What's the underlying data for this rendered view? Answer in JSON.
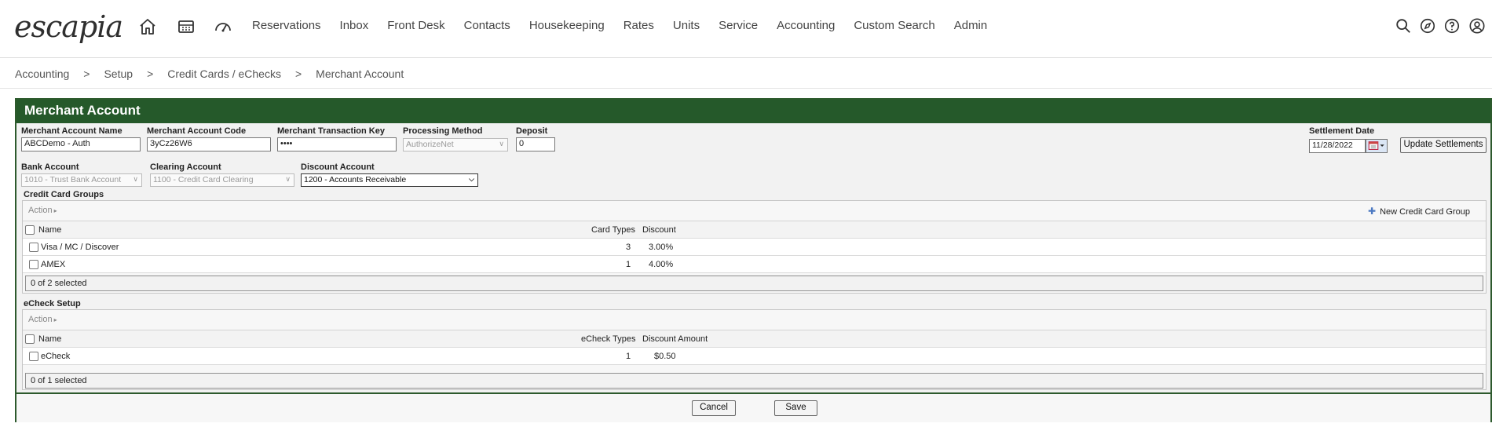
{
  "app": {
    "logo_text": "escapia",
    "nav": [
      "Reservations",
      "Inbox",
      "Front Desk",
      "Contacts",
      "Housekeeping",
      "Rates",
      "Units",
      "Service",
      "Accounting",
      "Custom Search",
      "Admin"
    ]
  },
  "breadcrumb": [
    "Accounting",
    "Setup",
    "Credit Cards / eChecks",
    "Merchant Account"
  ],
  "panel": {
    "title": "Merchant Account",
    "fields": {
      "merchant_account_name": {
        "label": "Merchant Account Name",
        "value": "ABCDemo - Auth"
      },
      "merchant_account_code": {
        "label": "Merchant Account Code",
        "value": "3yCz26W6"
      },
      "merchant_transaction_key": {
        "label": "Merchant Transaction Key",
        "value": "••••"
      },
      "processing_method": {
        "label": "Processing Method",
        "value": "AuthorizeNet"
      },
      "deposit": {
        "label": "Deposit",
        "value": "0"
      },
      "settlement_date": {
        "label": "Settlement Date",
        "value": "11/28/2022"
      },
      "bank_account": {
        "label": "Bank Account",
        "value": "1010 - Trust Bank Account"
      },
      "clearing_account": {
        "label": "Clearing Account",
        "value": "1100 - Credit Card Clearing"
      },
      "discount_account": {
        "label": "Discount Account",
        "value": "1200 - Accounts Receivable"
      }
    },
    "update_settlements_label": "Update Settlements",
    "credit_card_groups": {
      "title": "Credit Card Groups",
      "action_label": "Action",
      "new_label": "New Credit Card Group",
      "columns": [
        "Name",
        "Card Types",
        "Discount"
      ],
      "rows": [
        {
          "name": "Visa / MC / Discover",
          "types": "3",
          "discount": "3.00%"
        },
        {
          "name": "AMEX",
          "types": "1",
          "discount": "4.00%"
        }
      ],
      "footer": "0 of 2 selected"
    },
    "echeck_setup": {
      "title": "eCheck Setup",
      "action_label": "Action",
      "columns": [
        "Name",
        "eCheck Types",
        "Discount Amount"
      ],
      "rows": [
        {
          "name": "eCheck",
          "types": "1",
          "discount": "$0.50"
        }
      ],
      "footer": "0 of 1 selected"
    },
    "cancel_label": "Cancel",
    "save_label": "Save"
  },
  "colors": {
    "panel_header": "#25592a",
    "accent_blue": "#4b78c2"
  }
}
